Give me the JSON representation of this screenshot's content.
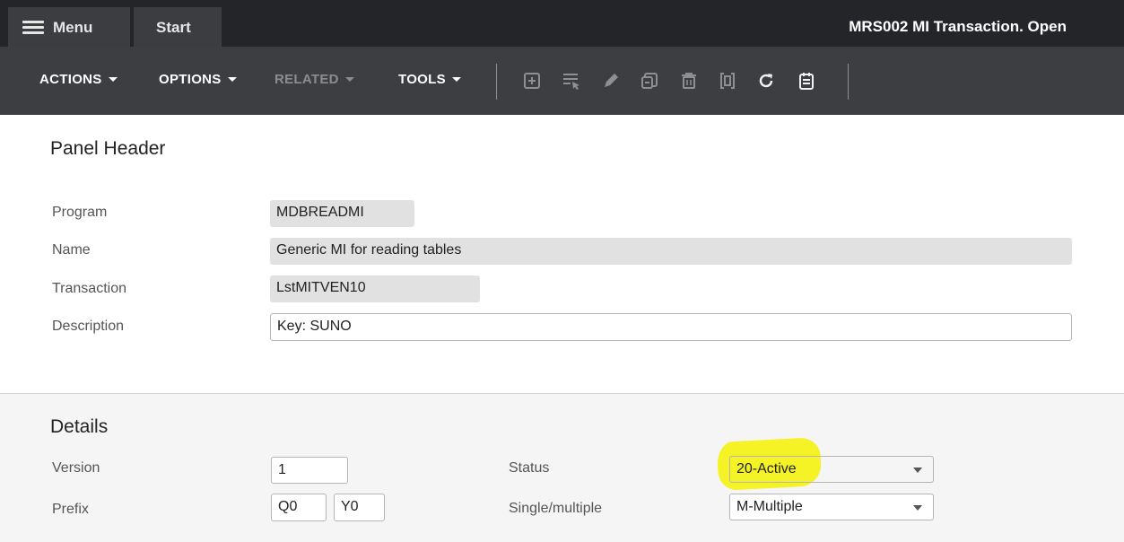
{
  "topbar": {
    "menu_label": "Menu",
    "start_label": "Start",
    "window_title": "MRS002 MI Transaction. Open"
  },
  "toolbar": {
    "actions_label": "ACTIONS",
    "options_label": "OPTIONS",
    "related_label": "RELATED",
    "tools_label": "TOOLS",
    "icons": [
      "add-icon",
      "column-select-icon",
      "edit-icon",
      "copy-icon",
      "delete-icon",
      "display-icon",
      "refresh-icon",
      "notes-icon"
    ]
  },
  "panel_header": {
    "title": "Panel Header",
    "program_label": "Program",
    "program_value": "MDBREADMI",
    "name_label": "Name",
    "name_value": "Generic MI for reading tables",
    "transaction_label": "Transaction",
    "transaction_value": "LstMITVEN10",
    "description_label": "Description",
    "description_value": "Key: SUNO"
  },
  "details": {
    "title": "Details",
    "version_label": "Version",
    "version_value": "1",
    "prefix_label": "Prefix",
    "prefix_value_1": "Q0",
    "prefix_value_2": "Y0",
    "status_label": "Status",
    "status_value": "20-Active",
    "single_multiple_label": "Single/multiple",
    "single_multiple_value": "M-Multiple"
  },
  "colors": {
    "topbar_bg": "#232528",
    "toolbar_bg": "#3c3e42",
    "highlight": "#f4f119"
  }
}
